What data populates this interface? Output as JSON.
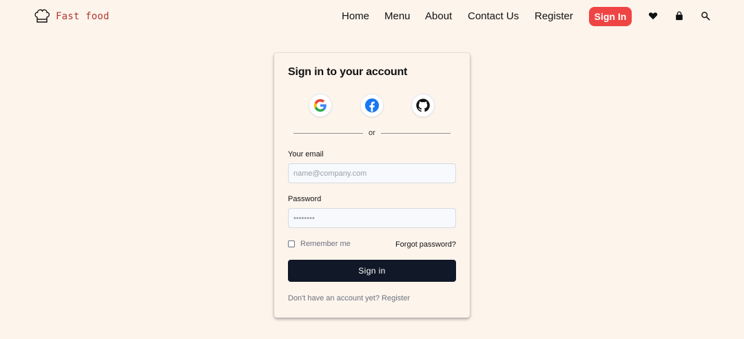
{
  "brand": {
    "name": "Fast food",
    "icon": "chef-hat-icon"
  },
  "nav": {
    "links": [
      "Home",
      "Menu",
      "About",
      "Contact Us",
      "Register"
    ],
    "signin_label": "Sign In",
    "signin_color": "#ef4444",
    "icons": [
      "heart-icon",
      "bag-icon",
      "search-icon"
    ]
  },
  "card": {
    "title": "Sign in to your account",
    "social": [
      "google-icon",
      "facebook-icon",
      "github-icon"
    ],
    "divider_text": "or",
    "email_label": "Your email",
    "email_placeholder": "name@company.com",
    "email_value": "",
    "password_label": "Password",
    "password_placeholder": "••••••••",
    "password_value": "",
    "remember_label": "Remember me",
    "remember_checked": false,
    "forgot_label": "Forgot password?",
    "submit_label": "Sign in",
    "register_prompt": "Don't have an account yet?",
    "register_link": "Register"
  },
  "colors": {
    "background": "#fdf4ec",
    "primary_button": "#111827",
    "brand_text": "#b23a2e"
  }
}
